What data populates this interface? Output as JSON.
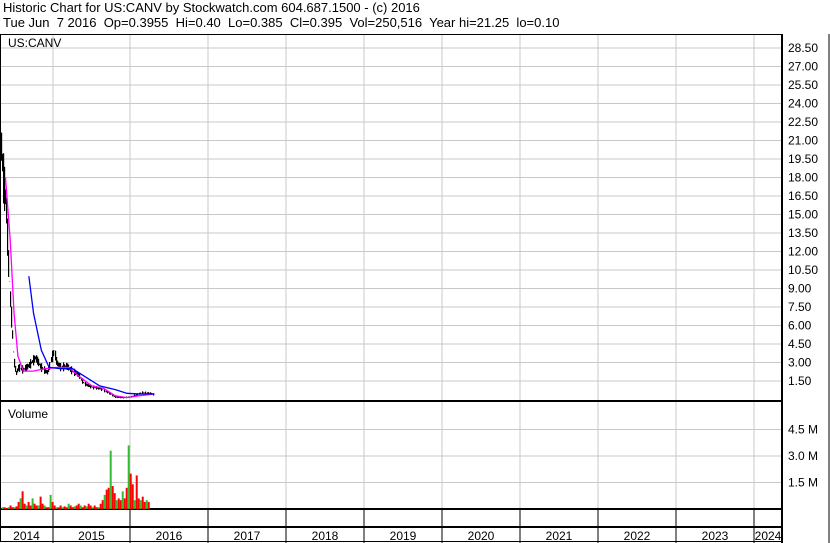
{
  "header": {
    "title": "Historic Chart for US:CANV by Stockwatch.com 604.687.1500 - (c) 2016",
    "quote": "Tue Jun  7 2016  Op=0.3955  Hi=0.40  Lo=0.385  Cl=0.395  Vol=250,516  Year hi=21.25  lo=0.10"
  },
  "chart_data": [
    {
      "type": "line",
      "title": "US:CANV",
      "ylim": [
        0,
        30
      ],
      "yticks": [
        "1.50",
        "3.00",
        "4.50",
        "6.00",
        "7.50",
        "9.00",
        "10.50",
        "12.00",
        "13.50",
        "15.00",
        "16.50",
        "18.00",
        "19.50",
        "21.00",
        "22.50",
        "24.00",
        "25.50",
        "27.00",
        "28.50"
      ],
      "xticks": [
        "2014",
        "2015",
        "2016",
        "2017",
        "2018",
        "2019",
        "2020",
        "2021",
        "2022",
        "2023",
        "2024"
      ],
      "xlim": [
        2014.32,
        2024.37
      ],
      "series": [
        {
          "name": "price",
          "color": "#000000",
          "points": [
            [
              2014.34,
              20.5
            ],
            [
              2014.37,
              17.5
            ],
            [
              2014.4,
              16
            ],
            [
              2014.43,
              11
            ],
            [
              2014.47,
              6.5
            ],
            [
              2014.5,
              3.2
            ],
            [
              2014.53,
              2.1
            ],
            [
              2014.56,
              2.6
            ],
            [
              2014.62,
              2.4
            ],
            [
              2014.7,
              2.8
            ],
            [
              2014.78,
              3.4
            ],
            [
              2014.85,
              2.6
            ],
            [
              2014.93,
              2.2
            ],
            [
              2015.02,
              4.0
            ],
            [
              2015.05,
              3.0
            ],
            [
              2015.1,
              2.6
            ],
            [
              2015.18,
              2.7
            ],
            [
              2015.25,
              2.3
            ],
            [
              2015.33,
              2.0
            ],
            [
              2015.4,
              1.3
            ],
            [
              2015.5,
              1.0
            ],
            [
              2015.6,
              0.9
            ],
            [
              2015.7,
              0.6
            ],
            [
              2015.8,
              0.2
            ],
            [
              2015.9,
              0.15
            ],
            [
              2016.0,
              0.2
            ],
            [
              2016.08,
              0.4
            ],
            [
              2016.15,
              0.55
            ],
            [
              2016.25,
              0.5
            ],
            [
              2016.3,
              0.4
            ]
          ]
        },
        {
          "name": "ma-short",
          "color": "#ff00ff",
          "points": [
            [
              2014.39,
              18
            ],
            [
              2014.45,
              13
            ],
            [
              2014.5,
              7
            ],
            [
              2014.55,
              3.5
            ],
            [
              2014.62,
              2.3
            ],
            [
              2014.75,
              2.3
            ],
            [
              2014.9,
              2.5
            ],
            [
              2015.05,
              2.6
            ],
            [
              2015.2,
              2.6
            ],
            [
              2015.35,
              1.8
            ],
            [
              2015.5,
              1.1
            ],
            [
              2015.65,
              0.9
            ],
            [
              2015.8,
              0.3
            ],
            [
              2015.95,
              0.15
            ],
            [
              2016.1,
              0.3
            ],
            [
              2016.3,
              0.45
            ]
          ]
        },
        {
          "name": "ma-long",
          "color": "#0000ff",
          "points": [
            [
              2014.69,
              10
            ],
            [
              2014.75,
              7
            ],
            [
              2014.85,
              4
            ],
            [
              2014.95,
              2.6
            ],
            [
              2015.1,
              2.5
            ],
            [
              2015.25,
              2.5
            ],
            [
              2015.45,
              1.7
            ],
            [
              2015.6,
              1.1
            ],
            [
              2015.8,
              0.8
            ],
            [
              2015.95,
              0.5
            ],
            [
              2016.1,
              0.45
            ],
            [
              2016.3,
              0.45
            ]
          ]
        }
      ]
    },
    {
      "type": "bar",
      "title": "Volume",
      "yticks": [
        "1.5 M",
        "3.0 M",
        "4.5 M"
      ],
      "ylim": [
        0,
        6.0
      ],
      "start": 2014.34,
      "step": 0.0257,
      "values": [
        0.1,
        0.1,
        0.05,
        0.1,
        0.2,
        0.1,
        0.1,
        0.15,
        0.4,
        0.6,
        1.0,
        0.3,
        0.2,
        0.4,
        0.2,
        0.6,
        0.3,
        0.2,
        0.2,
        0.7,
        0.3,
        0.2,
        0.1,
        0.1,
        0.8,
        0.4,
        0.2,
        0.1,
        0.1,
        0.2,
        0.1,
        0.15,
        0.1,
        0.3,
        0.2,
        0.1,
        0.15,
        0.2,
        0.3,
        0.2,
        0.1,
        0.2,
        0.15,
        0.3,
        0.2,
        0.1,
        0.2,
        0.1,
        0.1,
        0.3,
        0.5,
        0.8,
        1.1,
        1.2,
        3.3,
        1.3,
        0.9,
        0.5,
        0.6,
        0.5,
        1.0,
        0.6,
        1.2,
        3.6,
        2.0,
        1.4,
        0.5,
        1.9,
        0.6,
        0.5,
        0.7,
        0.4,
        0.5,
        0.4
      ],
      "colors": [
        "#ff0000",
        "#33bb33"
      ]
    }
  ]
}
